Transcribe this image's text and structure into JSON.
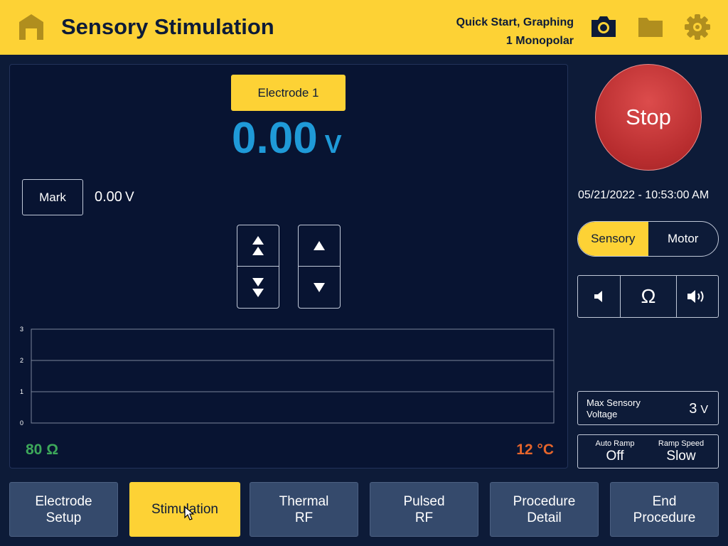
{
  "header": {
    "title": "Sensory Stimulation",
    "mode_line1": "Quick Start, Graphing",
    "mode_line2": "1 Monopolar",
    "icons": [
      "home-icon",
      "camera-icon",
      "folder-icon",
      "gear-icon"
    ]
  },
  "panel": {
    "electrode_label": "Electrode 1",
    "voltage_value": "0.00",
    "voltage_unit": "V",
    "mark_label": "Mark",
    "mark_value": "0.00",
    "mark_unit": "V",
    "impedance": "80 Ω",
    "temperature": "12 °C"
  },
  "chart_data": {
    "type": "line",
    "title": "",
    "xlabel": "",
    "ylabel": "",
    "ylim": [
      0,
      3
    ],
    "yticks": [
      "0",
      "1",
      "2",
      "3"
    ],
    "grid": true,
    "series": []
  },
  "side": {
    "stop_label": "Stop",
    "datetime": "05/21/2022 - 10:53:00 AM",
    "toggle": {
      "sensory": "Sensory",
      "motor": "Motor",
      "selected": "Sensory"
    },
    "omega": "Ω",
    "max_voltage_label": "Max Sensory Voltage",
    "max_voltage_value": "3",
    "max_voltage_unit": "V",
    "auto_ramp_label": "Auto Ramp",
    "auto_ramp_value": "Off",
    "ramp_speed_label": "Ramp Speed",
    "ramp_speed_value": "Slow"
  },
  "nav": [
    {
      "label": "Electrode\nSetup",
      "active": false
    },
    {
      "label": "Stimulation",
      "active": true
    },
    {
      "label": "Thermal\nRF",
      "active": false
    },
    {
      "label": "Pulsed\nRF",
      "active": false
    },
    {
      "label": "Procedure\nDetail",
      "active": false
    },
    {
      "label": "End\nProcedure",
      "active": false
    }
  ],
  "colors": {
    "accent": "#fdd235",
    "background": "#0d1b38",
    "voltage": "#1f9ad8",
    "impedance": "#3da85a",
    "temperature": "#e6652b",
    "stop": "#b72c2e"
  }
}
